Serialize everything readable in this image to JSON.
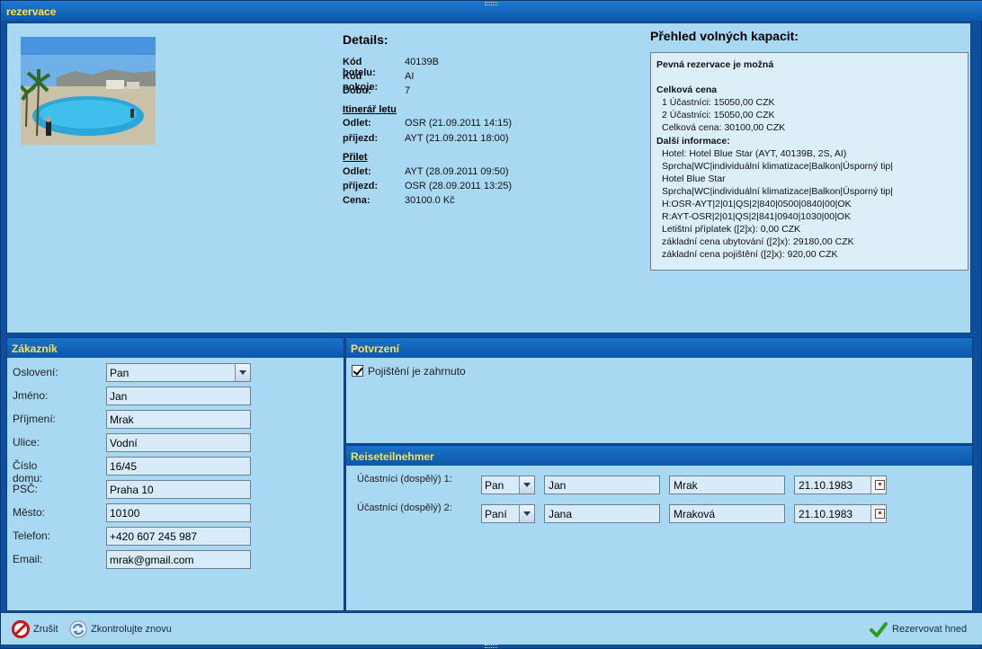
{
  "window": {
    "title": "rezervace"
  },
  "details": {
    "title": "Details:",
    "hotel_code_label": "Kód hotelu:",
    "hotel_code": "40139B",
    "room_code_label": "Kód pokoje:",
    "room_code": "AI",
    "duration_label": "Dobu:",
    "duration": "7",
    "itinerary_title": "Itinerář letu",
    "outbound": {
      "departure_label": "Odlet:",
      "departure": "OSR (21.09.2011 14:15)",
      "arrival_label": "příjezd:",
      "arrival": "AYT (21.09.2011 18:00)"
    },
    "return_title": "Přilet",
    "return": {
      "departure_label": "Odlet:",
      "departure": "AYT (28.09.2011 09:50)",
      "arrival_label": "příjezd:",
      "arrival": "OSR (28.09.2011 13:25)"
    },
    "price_label": "Cena:",
    "price": "30100.0 Kč"
  },
  "capacity": {
    "title": "Přehled volných kapacit:",
    "lines": [
      {
        "text": "Pevná rezervace je možná",
        "bold": true,
        "indent": false
      },
      {
        "text": "",
        "bold": false,
        "indent": false
      },
      {
        "text": "Celková cena",
        "bold": true,
        "indent": false
      },
      {
        "text": "1 Účastníci: 15050,00 CZK",
        "bold": false,
        "indent": true
      },
      {
        "text": "2 Účastníci: 15050,00 CZK",
        "bold": false,
        "indent": true
      },
      {
        "text": "Celková cena: 30100,00 CZK",
        "bold": false,
        "indent": true
      },
      {
        "text": "Další informace:",
        "bold": true,
        "indent": false
      },
      {
        "text": "Hotel: Hotel Blue Star (AYT, 40139B, 2S, AI)",
        "bold": false,
        "indent": true
      },
      {
        "text": "Sprcha|WC|individuální klimatizace|Balkon|Úsporný tip|",
        "bold": false,
        "indent": true
      },
      {
        "text": "Hotel Blue Star",
        "bold": false,
        "indent": true
      },
      {
        "text": "Sprcha|WC|individuální klimatizace|Balkon|Úsporný tip|",
        "bold": false,
        "indent": true
      },
      {
        "text": "H:OSR-AYT|2|01|QS|2|840|0500|0840|00|OK",
        "bold": false,
        "indent": true
      },
      {
        "text": "R:AYT-OSR|2|01|QS|2|841|0940|1030|00|OK",
        "bold": false,
        "indent": true
      },
      {
        "text": "Letištní příplatek ([2]x): 0,00 CZK",
        "bold": false,
        "indent": true
      },
      {
        "text": "základní cena ubytování ([2]x): 29180,00 CZK",
        "bold": false,
        "indent": true
      },
      {
        "text": "základní cena pojištění ([2]x): 920,00 CZK",
        "bold": false,
        "indent": true
      }
    ]
  },
  "customer": {
    "title": "Zákazník",
    "salutation_label": "Oslovení:",
    "salutation": "Pan",
    "first_name_label": "Jméno:",
    "first_name": "Jan",
    "last_name_label": "Příjmení:",
    "last_name": "Mrak",
    "street_label": "Ulice:",
    "street": "Vodní",
    "house_number_label": "Číslo domu:",
    "house_number": "16/45",
    "zip_label": "PSČ:",
    "zip": "Praha 10",
    "city_label": "Město:",
    "city": "10100",
    "phone_label": "Telefon:",
    "phone": "+420 607 245 987",
    "email_label": "Email:",
    "email": "mrak@gmail.com"
  },
  "confirmation": {
    "title": "Potvrzení",
    "insurance_label": "Pojištění je zahrnuto",
    "insurance_checked": true
  },
  "travellers": {
    "title": "Reiseteilnehmer",
    "rows": [
      {
        "label": "Účastníci (dospělý) 1:",
        "salutation": "Pan",
        "first_name": "Jan",
        "last_name": "Mrak",
        "birth_date": "21.10.1983"
      },
      {
        "label": "Účastníci (dospělý) 2:",
        "salutation": "Paní",
        "first_name": "Jana",
        "last_name": "Mraková",
        "birth_date": "21.10.1983"
      }
    ]
  },
  "footer": {
    "cancel_label": "Zrušit",
    "recheck_label": "Zkontrolujte znovu",
    "book_label": "Rezervovat hned"
  },
  "colors": {
    "header_text": "#ffe34a",
    "panel_bg": "#a9d8f3",
    "header_bg": "#0b56ab"
  }
}
